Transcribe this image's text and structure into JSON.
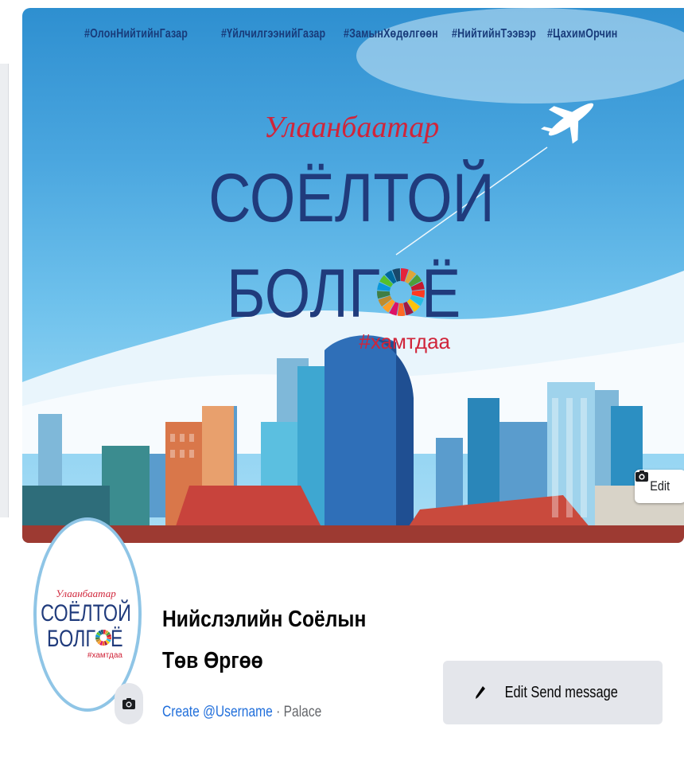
{
  "cover": {
    "hashtags": [
      "#ОлонНийтийнГазар",
      "#ҮйлчилгээнийГазар",
      "#ЗамынХөдөлгөөн",
      "#НийтийнТээвэр",
      "#ЦахимОрчин"
    ],
    "script_title": "Улаанбаатар",
    "title_line1": "СОЁЛТОЙ",
    "title_line2": "БОЛГ",
    "title_line2_end": "Ё",
    "tagline": "#хамтдаа",
    "edit_label": "Edit",
    "sdg_colors": [
      "#e5243b",
      "#dda63a",
      "#4c9f38",
      "#c5192d",
      "#ff3a21",
      "#26bde2",
      "#fcc30b",
      "#a21942",
      "#fd6925",
      "#dd1367",
      "#fd9d24",
      "#bf8b2e",
      "#3f7e44",
      "#0a97d9",
      "#56c02b",
      "#00689d",
      "#19486a"
    ]
  },
  "avatar": {
    "script_title": "Улаанбаатар",
    "title_line1": "СОЁЛТОЙ",
    "title_line2": "БОЛГ",
    "title_line2_end": "Ё",
    "tagline": "#хамтдаа"
  },
  "page": {
    "name": "Нийслэлийн Соёлын Төв Өргөө",
    "username_link": "Create @Username",
    "separator": " · ",
    "category": "Palace"
  },
  "actions": {
    "primary_label": "Edit Send message"
  },
  "colors": {
    "link": "#216fdb",
    "title_navy": "#203b7c",
    "script_red": "#d0253a",
    "button_bg": "#e4e6eb"
  }
}
